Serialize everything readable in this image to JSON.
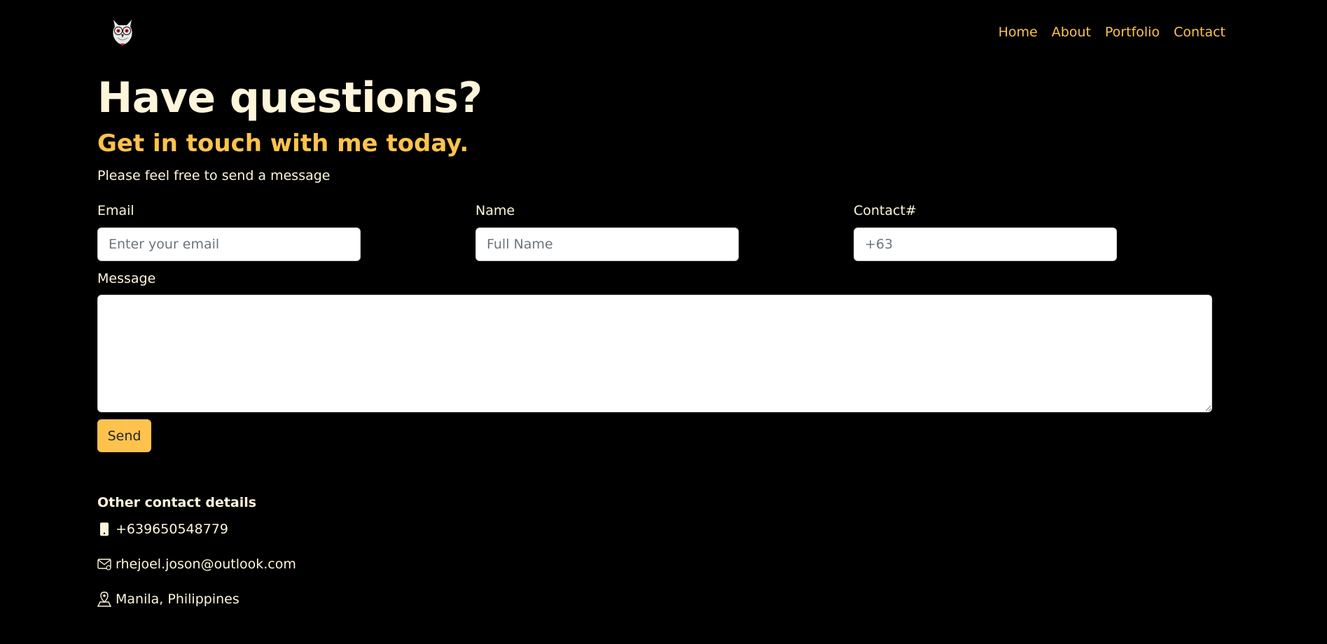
{
  "header": {
    "logo_icon": "owl-logo-icon",
    "nav": [
      {
        "label": "Home"
      },
      {
        "label": "About"
      },
      {
        "label": "Portfolio"
      },
      {
        "label": "Contact"
      }
    ]
  },
  "main": {
    "heading": "Have questions?",
    "subheading": "Get in touch with me today.",
    "intro": "Please feel free to send a message"
  },
  "form": {
    "email": {
      "label": "Email",
      "value": "",
      "placeholder": "Enter your email"
    },
    "name": {
      "label": "Name",
      "value": "",
      "placeholder": "Full Name"
    },
    "contact": {
      "label": "Contact#",
      "value": "",
      "placeholder": "+63"
    },
    "message": {
      "label": "Message",
      "value": ""
    },
    "send_label": "Send"
  },
  "other_contacts": {
    "title": "Other contact details",
    "items": [
      {
        "icon": "phone-icon",
        "text": "+639650548779"
      },
      {
        "icon": "envelope-icon",
        "text": "rhejoel.joson@outlook.com"
      },
      {
        "icon": "map-pin-icon",
        "text": "Manila, Philippines"
      }
    ]
  },
  "colors": {
    "background": "#000000",
    "accent": "#FFC34D",
    "text": "#FFF5DA"
  }
}
